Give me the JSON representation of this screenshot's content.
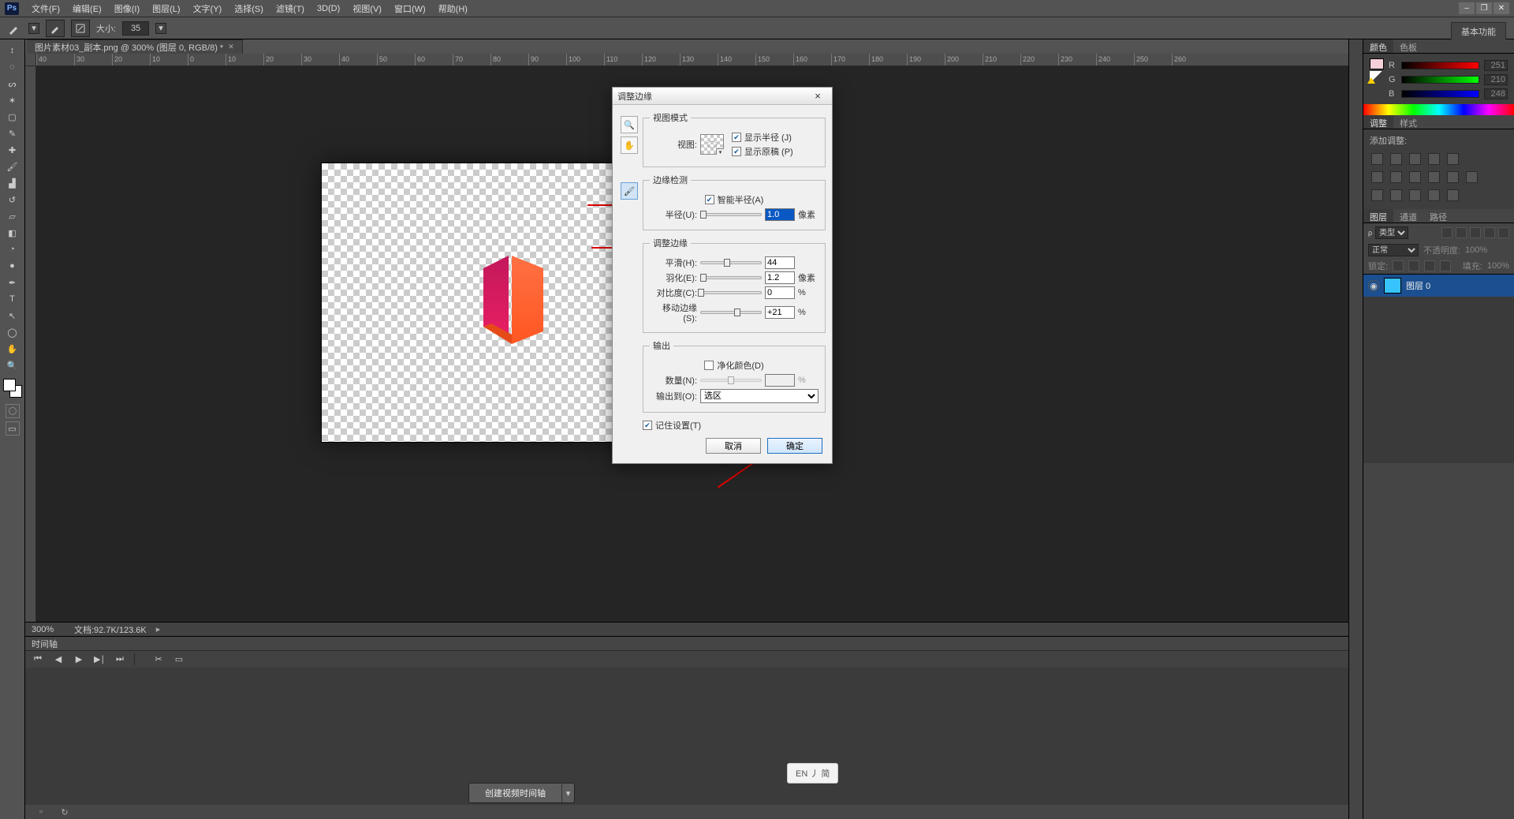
{
  "app": {
    "logo": "Ps"
  },
  "menu": {
    "items": [
      "文件(F)",
      "编辑(E)",
      "图像(I)",
      "图层(L)",
      "文字(Y)",
      "选择(S)",
      "滤镜(T)",
      "3D(D)",
      "视图(V)",
      "窗口(W)",
      "帮助(H)"
    ]
  },
  "workspace_tab": "基本功能",
  "options": {
    "size_label": "大小:",
    "size_value": "35"
  },
  "doc_tab": "图片素材03_副本.png @ 300% (图层 0, RGB/8) *",
  "ruler_ticks": [
    "40",
    "30",
    "20",
    "10",
    "0",
    "10",
    "20",
    "30",
    "40",
    "50",
    "60",
    "70",
    "80",
    "90",
    "100",
    "110",
    "120",
    "130",
    "140",
    "150",
    "160",
    "170",
    "180",
    "190",
    "200",
    "210",
    "220",
    "230",
    "240",
    "250",
    "260"
  ],
  "status": {
    "zoom": "300%",
    "doc": "文档:92.7K/123.6K"
  },
  "timeline": {
    "tab": "时间轴",
    "create_btn": "创建视频时间轴"
  },
  "ime": "EN 丿 简",
  "panels": {
    "color": {
      "tabs": [
        "颜色",
        "色板"
      ],
      "channels": [
        {
          "key": "R",
          "value": "251"
        },
        {
          "key": "G",
          "value": "210"
        },
        {
          "key": "B",
          "value": "248"
        }
      ]
    },
    "adjust": {
      "tabs": [
        "调整",
        "样式"
      ],
      "header": "添加调整:"
    },
    "layers": {
      "tabs": [
        "图层",
        "通道",
        "路径"
      ],
      "filter_label": "类型",
      "blend_mode": "正常",
      "opacity_label": "不透明度:",
      "opacity_value": "100%",
      "lock_label": "锁定:",
      "fill_label": "填充:",
      "fill_value": "100%",
      "layer_name": "图层 0"
    }
  },
  "dialog": {
    "title": "调整边缘",
    "group_view": "视图模式",
    "view_label": "视图:",
    "show_radius": "显示半径 (J)",
    "show_original": "显示原稿 (P)",
    "group_edge": "边缘检测",
    "smart_radius": "智能半径(A)",
    "radius_label": "半径(U):",
    "radius_value": "1.0",
    "pixels": "像素",
    "group_adjust": "调整边缘",
    "smooth_label": "平滑(H):",
    "smooth_value": "44",
    "feather_label": "羽化(E):",
    "feather_value": "1.2",
    "contrast_label": "对比度(C):",
    "contrast_value": "0",
    "percent": "%",
    "shift_label": "移动边缘(S):",
    "shift_value": "+21",
    "group_output": "输出",
    "decon_label": "净化颜色(D)",
    "amount_label": "数量(N):",
    "output_label": "输出到(O):",
    "output_value": "选区",
    "remember": "记住设置(T)",
    "cancel": "取消",
    "ok": "确定"
  }
}
